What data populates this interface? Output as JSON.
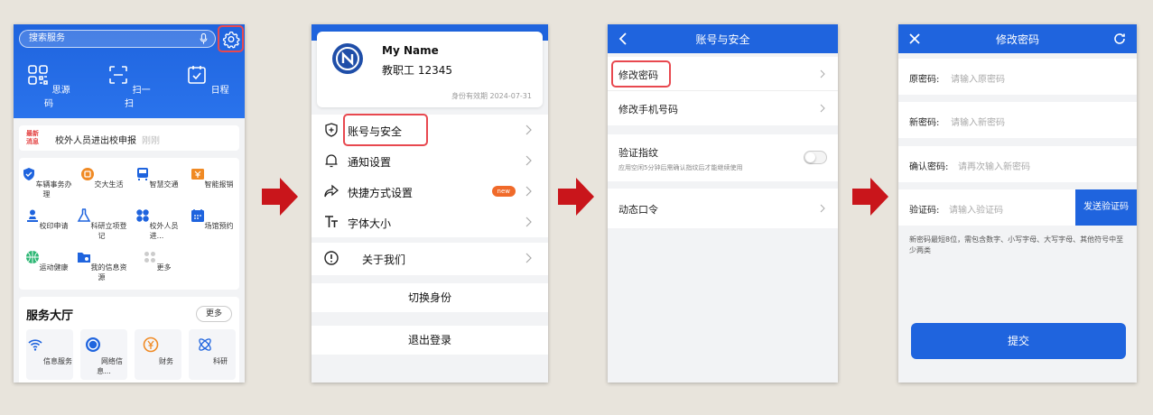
{
  "screen1": {
    "search_placeholder": "搜索服务",
    "quick_actions": [
      "思源码",
      "扫一扫",
      "日程"
    ],
    "notice": {
      "tag": "最新消息",
      "text": "校外人员进出校申报",
      "more": "刚刚"
    },
    "grid_items": [
      "车辆事务办理",
      "交大生活",
      "智慧交通",
      "智能报销",
      "校印申请",
      "科研立项登记",
      "校外人员进...",
      "场馆预约",
      "运动健康",
      "我的信息资源",
      "更多"
    ],
    "hall": {
      "title": "服务大厅",
      "more": "更多",
      "tiles": [
        "信息服务",
        "网络信息...",
        "财务",
        "科研"
      ]
    }
  },
  "screen2": {
    "watermark": "SJTU",
    "name": "My Name",
    "role": "教职工  12345",
    "valid": "身份有效期  2024-07-31",
    "menu1": [
      "账号与安全",
      "通知设置",
      "快捷方式设置",
      "字体大小"
    ],
    "new_badge": "new",
    "menu2": [
      "关于我们"
    ],
    "switch_identity": "切换身份",
    "logout": "退出登录"
  },
  "screen3": {
    "title": "账号与安全",
    "change_password": "修改密码",
    "change_phone": "修改手机号码",
    "fingerprint": "验证指纹",
    "fingerprint_sub": "应用空闲5分钟后需确认指纹后才能继续使用",
    "otp": "动态口令"
  },
  "screen4": {
    "title": "修改密码",
    "old_label": "原密码:",
    "old_placeholder": "请输入原密码",
    "new_label": "新密码:",
    "new_placeholder": "请输入新密码",
    "confirm_label": "确认密码:",
    "confirm_placeholder": "请再次输入新密码",
    "code_label": "验证码:",
    "code_placeholder": "请输入验证码",
    "send_code": "发送验证码",
    "hint": "新密码最短8位，需包含数字、小写字母、大写字母、其他符号中至少两类",
    "submit": "提交"
  },
  "colors": {
    "primary": "#1f64de",
    "highlight": "#e8484f",
    "arrow": "#c9151b"
  }
}
